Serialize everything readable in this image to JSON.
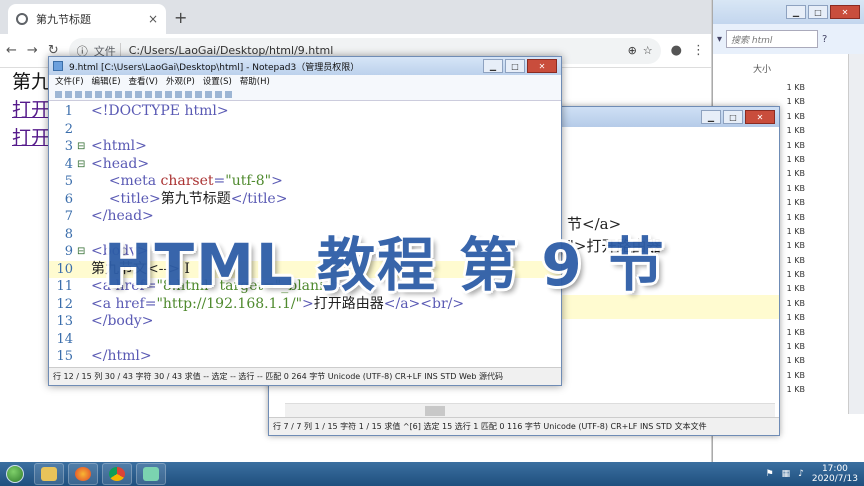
{
  "browser": {
    "tab_title": "第九节标题",
    "tab_close": "×",
    "new_tab": "+",
    "file_label": "文件",
    "address": "C:/Users/LaoGai/Desktop/html/9.html",
    "page_title_text": "第九节",
    "page_links": [
      "打开",
      "打开"
    ]
  },
  "explorer": {
    "search_placeholder": "搜索 html",
    "size_header": "大小",
    "file_sizes": [
      "1 KB",
      "1 KB",
      "1 KB",
      "1 KB",
      "1 KB",
      "1 KB",
      "1 KB",
      "1 KB",
      "1 KB",
      "1 KB",
      "1 KB",
      "1 KB",
      "1 KB",
      "1 KB",
      "1 KB",
      "1 KB",
      "1 KB",
      "1 KB",
      "1 KB",
      "1 KB",
      "1 KB",
      "1 KB"
    ]
  },
  "notepad_front": {
    "title": "9.html [C:\\Users\\LaoGai\\Desktop\\html] - Notepad3（管理员权限）",
    "menu": [
      "文件(F)",
      "编辑(E)",
      "查看(V)",
      "外观(P)",
      "设置(S)",
      "帮助(H)"
    ],
    "lines": [
      {
        "n": "1",
        "fold": "",
        "parts": [
          {
            "c": "c-tag",
            "t": "<!DOCTYPE html>"
          }
        ]
      },
      {
        "n": "2",
        "fold": "",
        "parts": []
      },
      {
        "n": "3",
        "fold": "⊟",
        "parts": [
          {
            "c": "c-tag",
            "t": "<html>"
          }
        ]
      },
      {
        "n": "4",
        "fold": "⊟",
        "parts": [
          {
            "c": "c-tag",
            "t": "<head>"
          }
        ]
      },
      {
        "n": "5",
        "fold": "",
        "parts": [
          {
            "c": "c-txt",
            "t": "    "
          },
          {
            "c": "c-tag",
            "t": "<meta "
          },
          {
            "c": "c-attr",
            "t": "charset"
          },
          {
            "c": "c-tag",
            "t": "="
          },
          {
            "c": "c-val",
            "t": "\"utf-8\""
          },
          {
            "c": "c-tag",
            "t": ">"
          }
        ]
      },
      {
        "n": "6",
        "fold": "",
        "parts": [
          {
            "c": "c-txt",
            "t": "    "
          },
          {
            "c": "c-tag",
            "t": "<title>"
          },
          {
            "c": "c-txt",
            "t": "第九节标题"
          },
          {
            "c": "c-tag",
            "t": "</title>"
          }
        ]
      },
      {
        "n": "7",
        "fold": "",
        "parts": [
          {
            "c": "c-tag",
            "t": "</head>"
          }
        ]
      },
      {
        "n": "8",
        "fold": "",
        "parts": []
      },
      {
        "n": "9",
        "fold": "⊟",
        "parts": [
          {
            "c": "c-tag",
            "t": "<body>"
          }
        ]
      },
      {
        "n": "10",
        "fold": "",
        "parts": [
          {
            "c": "c-txt",
            "t": "第九节文<--> I"
          }
        ]
      },
      {
        "n": "11",
        "fold": "",
        "parts": [
          {
            "c": "c-tag",
            "t": "<a href="
          },
          {
            "c": "c-val",
            "t": "\"8.html\" target=\"_blank\""
          },
          {
            "c": "c-tag",
            "t": ">"
          }
        ]
      },
      {
        "n": "12",
        "fold": "",
        "parts": [
          {
            "c": "c-tag",
            "t": "<a href="
          },
          {
            "c": "c-val",
            "t": "\"http://192.168.1.1/\""
          },
          {
            "c": "c-tag",
            "t": ">"
          },
          {
            "c": "c-txt",
            "t": "打开路由器"
          },
          {
            "c": "c-tag",
            "t": "</a><br/>"
          }
        ]
      },
      {
        "n": "13",
        "fold": "",
        "parts": [
          {
            "c": "c-tag",
            "t": "</body>"
          }
        ]
      },
      {
        "n": "14",
        "fold": "",
        "parts": []
      },
      {
        "n": "15",
        "fold": "",
        "parts": [
          {
            "c": "c-tag",
            "t": "</html>"
          }
        ]
      }
    ],
    "status": "行 12 / 15   列 30 / 43  字符 30 / 43  求值 --  选定 -- 选行 -- 匹配 0   264 字节  Unicode (UTF-8)  CR+LF  INS  STD  Web 源代码"
  },
  "notepad_back": {
    "code_lines": [
      "节</a>",
      "\">打开路由器",
      ""
    ],
    "status": "行 7 / 7      列 1 / 15  字符 1 / 15  求值 ^[6]  选定 15  选行 1    匹配 0     116 字节  Unicode (UTF-8)  CR+LF  INS  STD  文本文件"
  },
  "overlay": {
    "banner": "HTML 教程 第 9 节"
  },
  "taskbar": {
    "time": "17:00",
    "date": "2020/7/13"
  },
  "colors": {
    "banner": "#2e5da7",
    "link": "#551a8b",
    "taskbar": "#1f4f7e"
  }
}
